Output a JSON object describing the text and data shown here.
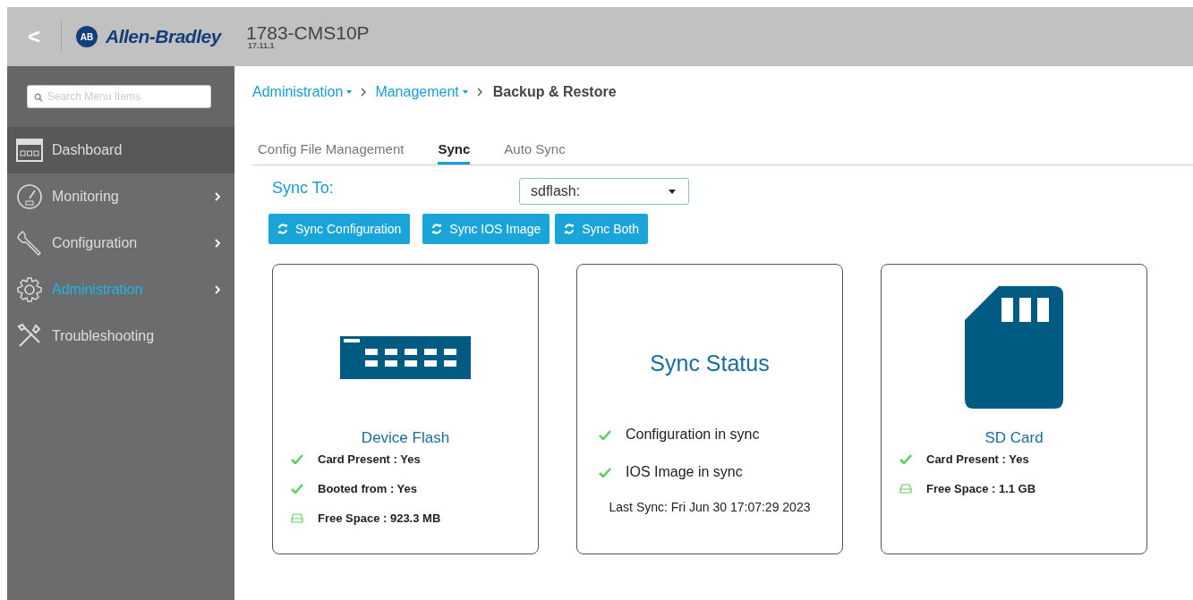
{
  "header": {
    "back": "<",
    "logo_mark": "AB",
    "brand": "Allen-Bradley",
    "device": "1783-CMS10P",
    "version": "17.11.1"
  },
  "sidebar": {
    "search": {
      "placeholder": "Search Menu Items"
    },
    "items": [
      {
        "label": "Dashboard",
        "kind": "dashboard",
        "selected": true,
        "submenu": false
      },
      {
        "label": "Monitoring",
        "kind": "monitoring",
        "selected": false,
        "submenu": true
      },
      {
        "label": "Configuration",
        "kind": "configuration",
        "selected": false,
        "submenu": true
      },
      {
        "label": "Administration",
        "kind": "administration",
        "selected": false,
        "submenu": true,
        "active": true
      },
      {
        "label": "Troubleshooting",
        "kind": "troubleshooting",
        "selected": false,
        "submenu": false
      }
    ]
  },
  "breadcrumb": [
    {
      "label": "Administration",
      "dropdown": true
    },
    {
      "label": "Management",
      "dropdown": true
    },
    {
      "label": "Backup & Restore",
      "dropdown": false
    }
  ],
  "tabs": [
    {
      "label": "Config File Management",
      "selected": false
    },
    {
      "label": "Sync",
      "selected": true
    },
    {
      "label": "Auto Sync",
      "selected": false
    }
  ],
  "sync_to": {
    "label": "Sync To:",
    "value": "sdflash:"
  },
  "buttons": [
    "Sync Configuration",
    "Sync IOS Image",
    "Sync Both"
  ],
  "cards": [
    {
      "kind": "flash",
      "title": "Device Flash",
      "lines": [
        {
          "kind": "check",
          "text": "Card Present : Yes"
        },
        {
          "kind": "check",
          "text": "Booted from : Yes"
        },
        {
          "kind": "disk",
          "text": "Free Space : 923.3 MB"
        }
      ]
    },
    {
      "kind": "status",
      "title": "Sync Status",
      "lines": [
        {
          "kind": "check",
          "text": "Configuration in sync"
        },
        {
          "kind": "check",
          "text": "IOS Image in sync"
        }
      ],
      "footer": "Last Sync: Fri Jun 30 17:07:29 2023"
    },
    {
      "kind": "sd",
      "title": "SD Card",
      "lines": [
        {
          "kind": "check",
          "text": "Card Present : Yes"
        },
        {
          "kind": "disk",
          "text": "Free Space : 1.1 GB"
        }
      ]
    }
  ]
}
